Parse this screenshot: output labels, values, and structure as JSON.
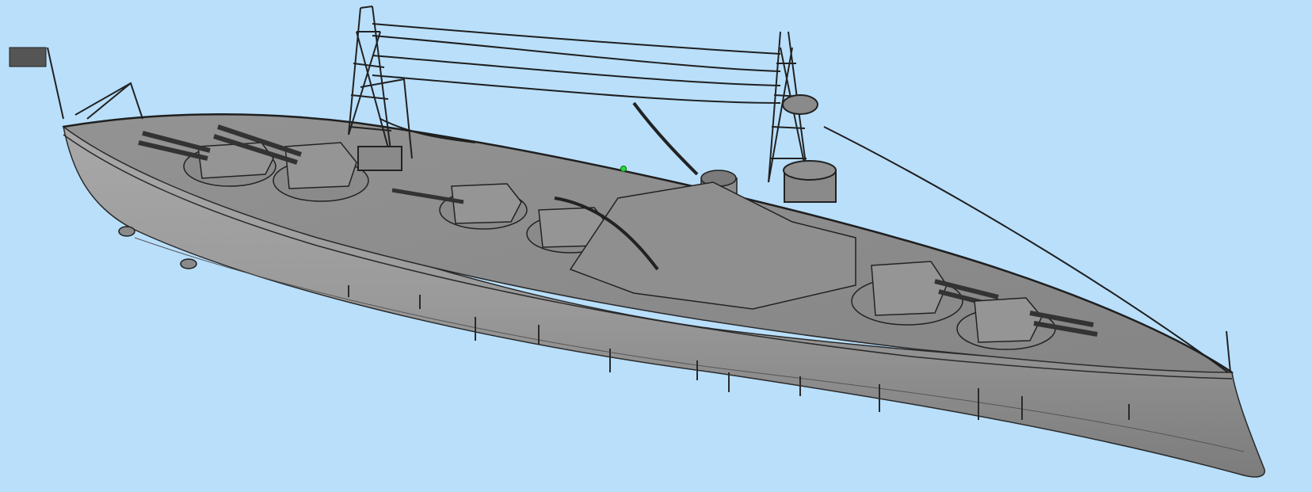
{
  "viewport": {
    "background_color": "#b9dffb",
    "model": "battleship-3d-model",
    "render_style": "shaded-with-edges",
    "hull_color": "#9a9a9a",
    "deck_color": "#8c8c8c",
    "edge_color": "#2a2a2a",
    "selection_marker_color": "#22dd33"
  }
}
